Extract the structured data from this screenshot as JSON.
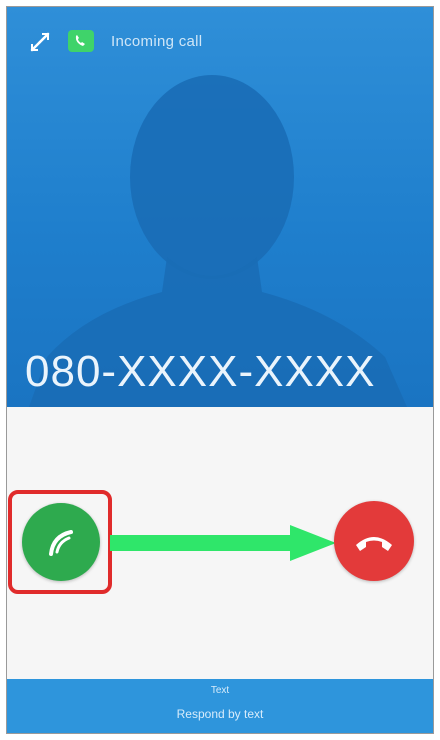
{
  "status_bar": {
    "text": "Incoming call",
    "arrows_icon": "transfer-arrows-icon",
    "app_icon": "phone-app-icon"
  },
  "caller": {
    "number": "080-XXXX-XXXX"
  },
  "actions": {
    "answer_icon": "phone-answer-icon",
    "decline_icon": "phone-decline-icon"
  },
  "bottom_bar": {
    "line1": "Text",
    "line2": "Respond by text"
  },
  "colors": {
    "header": "#1f7fcd",
    "answer": "#2eaa4e",
    "decline": "#e33a3a",
    "swipe_arrow": "#2fe66a",
    "highlight": "#e02b2b",
    "bottom_bar": "#2e95dc"
  }
}
